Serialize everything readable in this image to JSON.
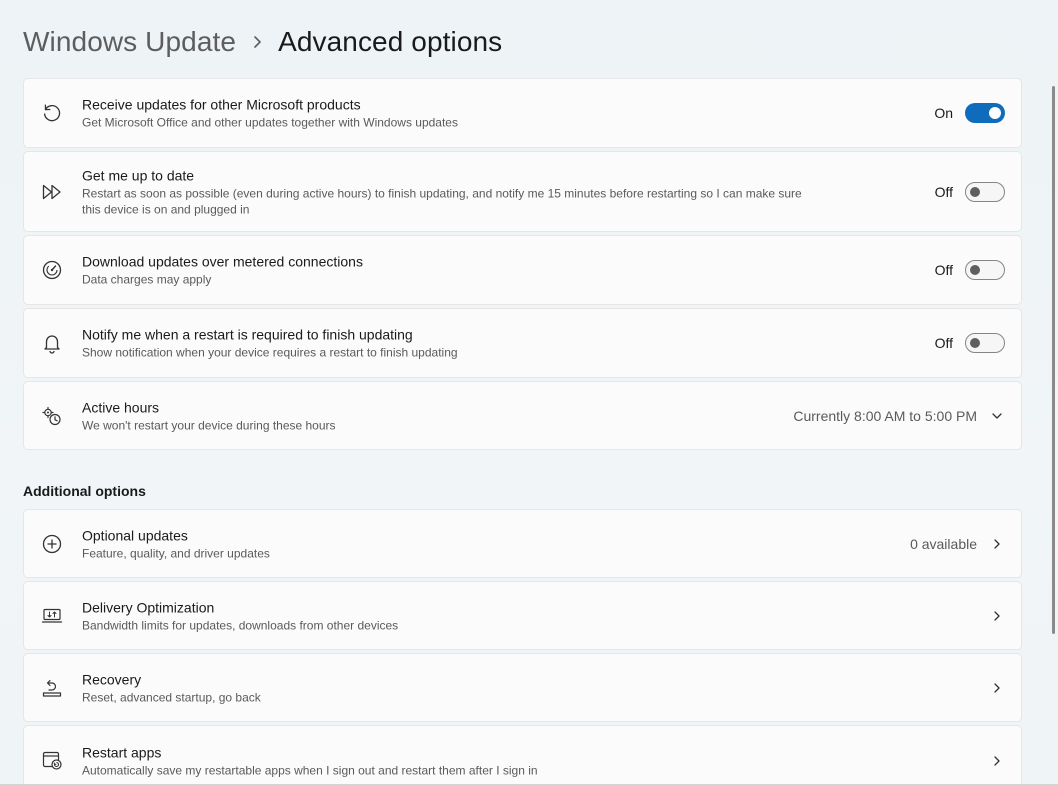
{
  "breadcrumb": {
    "parent": "Windows Update",
    "current": "Advanced options"
  },
  "settings": [
    {
      "title": "Receive updates for other Microsoft products",
      "desc": "Get Microsoft Office and other updates together with Windows updates",
      "state": "On",
      "toggle": true,
      "icon": "refresh-icon"
    },
    {
      "title": "Get me up to date",
      "desc": "Restart as soon as possible (even during active hours) to finish updating, and notify me 15 minutes before restarting so I can make sure this device is on and plugged in",
      "state": "Off",
      "toggle": false,
      "icon": "fast-forward-icon"
    },
    {
      "title": "Download updates over metered connections",
      "desc": "Data charges may apply",
      "state": "Off",
      "toggle": false,
      "icon": "speedometer-icon"
    },
    {
      "title": "Notify me when a restart is required to finish updating",
      "desc": "Show notification when your device requires a restart to finish updating",
      "state": "Off",
      "toggle": false,
      "icon": "bell-icon"
    },
    {
      "title": "Active hours",
      "desc": "We won't restart your device during these hours",
      "value": "Currently 8:00 AM to 5:00 PM",
      "icon": "clock-gear-icon"
    }
  ],
  "additional": {
    "title": "Additional options",
    "items": [
      {
        "title": "Optional updates",
        "desc": "Feature, quality, and driver updates",
        "value": "0 available",
        "icon": "plus-circle-icon"
      },
      {
        "title": "Delivery Optimization",
        "desc": "Bandwidth limits for updates, downloads from other devices",
        "icon": "laptop-transfer-icon"
      },
      {
        "title": "Recovery",
        "desc": "Reset, advanced startup, go back",
        "icon": "recovery-icon"
      },
      {
        "title": "Restart apps",
        "desc": "Automatically save my restartable apps when I sign out and restart them after I sign in",
        "icon": "restart-apps-icon"
      }
    ]
  },
  "colors": {
    "accent": "#0f6cbd",
    "background": "#eef3f6",
    "card": "#fbfbfb"
  }
}
